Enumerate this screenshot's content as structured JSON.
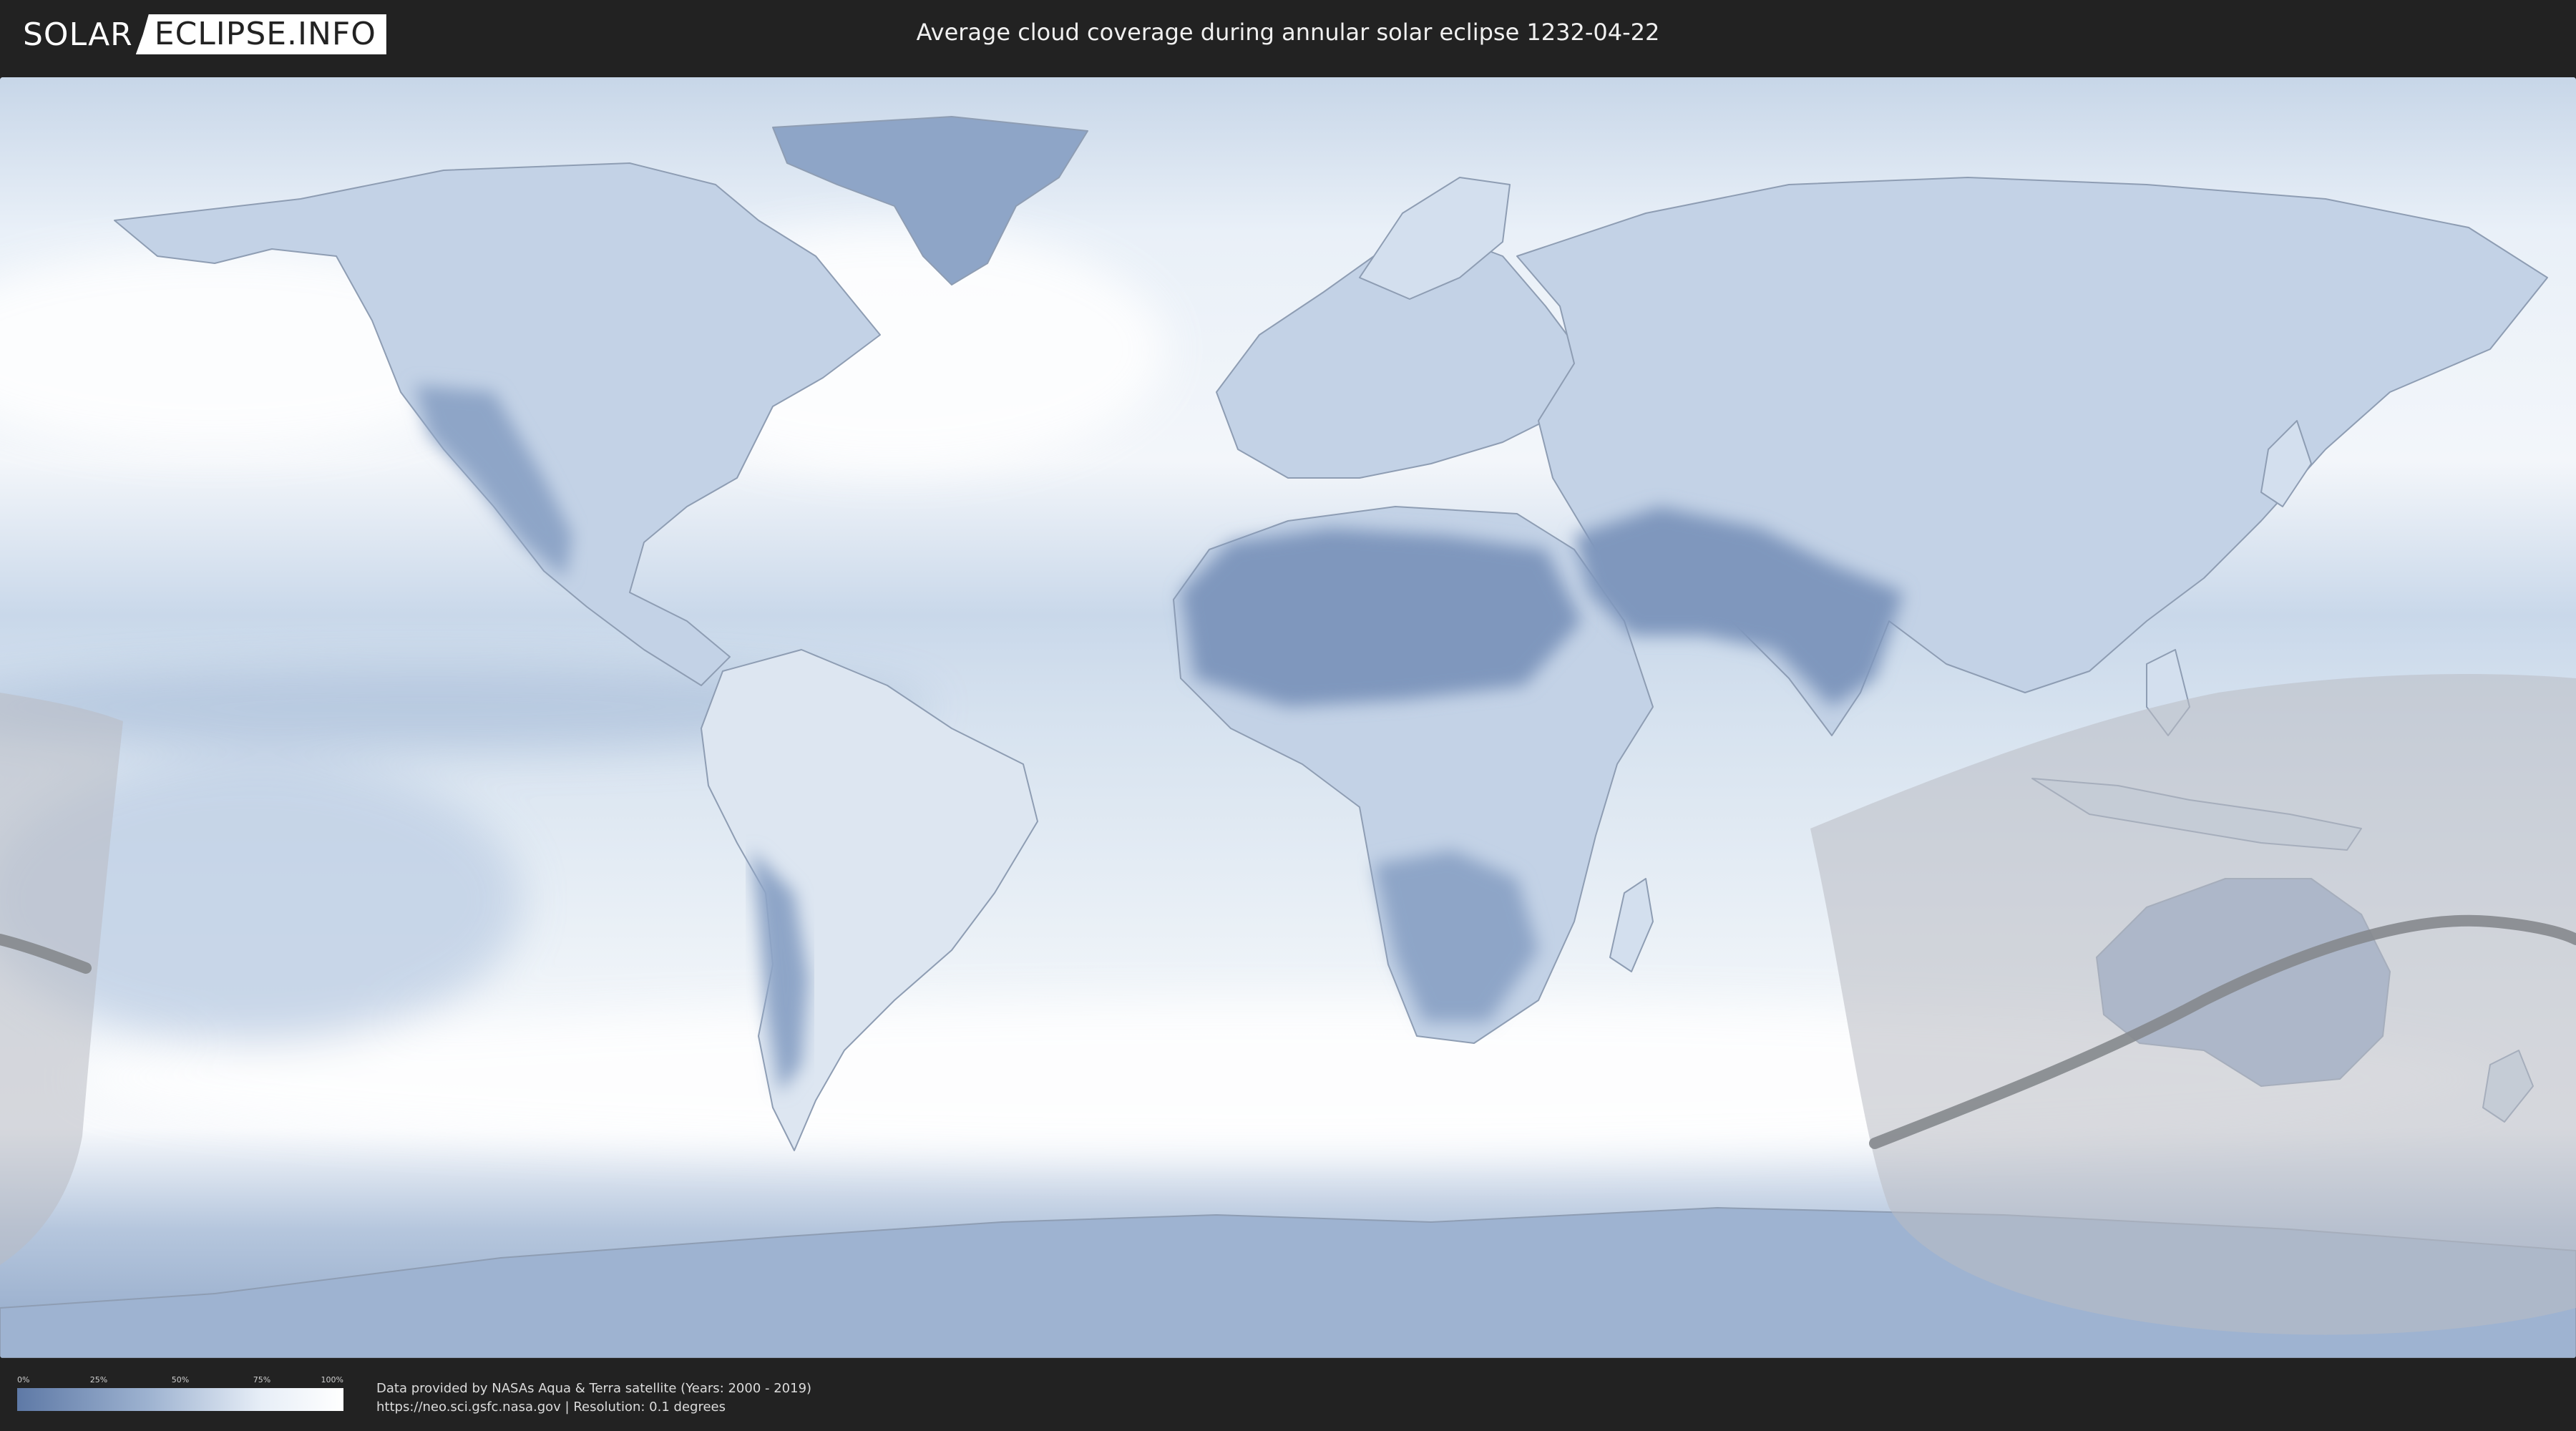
{
  "header": {
    "logo_left": "SOLAR",
    "logo_right": "ECLIPSE.INFO",
    "title": "Average cloud coverage during annular solar eclipse 1232-04-22"
  },
  "legend": {
    "ticks": [
      "0%",
      "25%",
      "50%",
      "75%",
      "100%"
    ],
    "colors": {
      "low": "#5e79a6",
      "high": "#ffffff"
    }
  },
  "credits": {
    "line1": "Data provided by NASAs Aqua & Terra satellite (Years: 2000 - 2019)",
    "line2": "https://neo.sci.gsfc.nasa.gov | Resolution: 0.1 degrees"
  },
  "map": {
    "projection": "equirectangular",
    "colors": {
      "clear": "#6f88b3",
      "cloudy": "#f4f7fb",
      "shadow": "#c9ccd2",
      "path": "#7f8287"
    }
  }
}
